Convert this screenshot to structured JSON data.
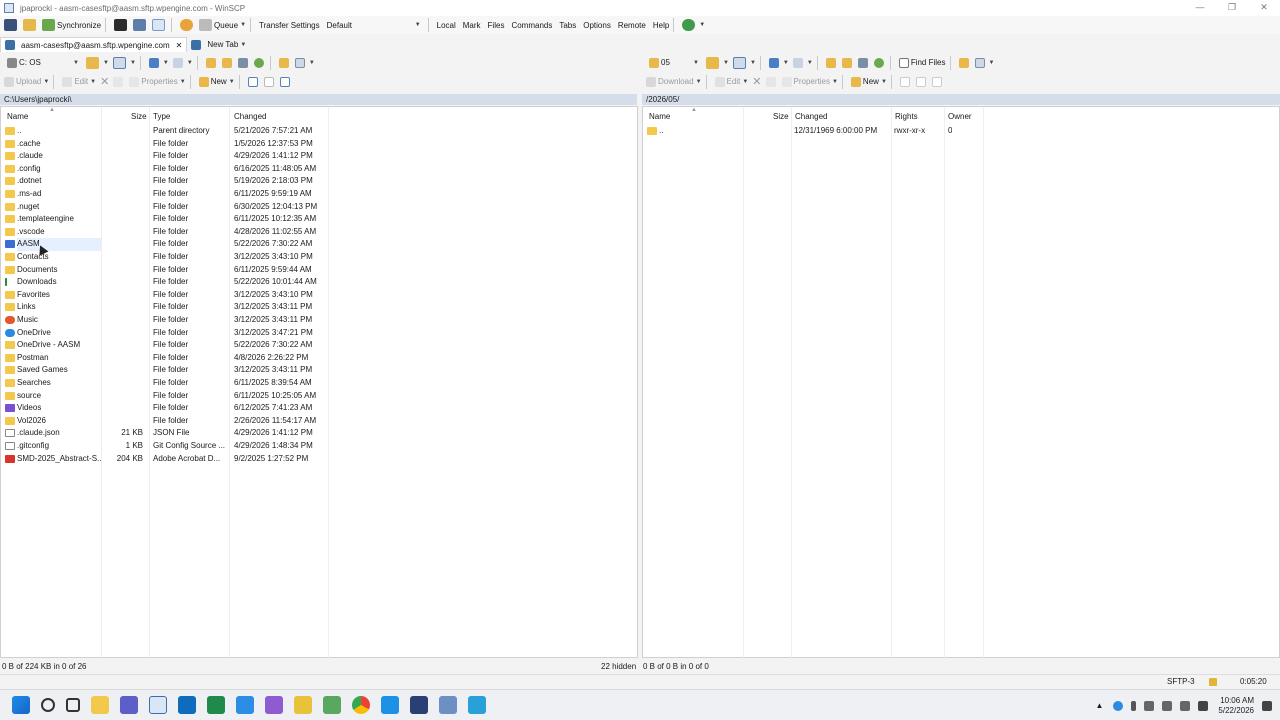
{
  "window": {
    "title": "jpaprocki - aasm-casesftp@aasm.sftp.wpengine.com - WinSCP",
    "controls": [
      "—",
      "❐",
      "✕"
    ]
  },
  "toolbar": {
    "synchronize": "Synchronize",
    "queue": "Queue",
    "transfer_settings": "Transfer Settings",
    "transfer_preset": "Default",
    "menus": [
      "Local",
      "Mark",
      "Files",
      "Commands",
      "Tabs",
      "Options",
      "Remote",
      "Help"
    ]
  },
  "tabs": {
    "session": "aasm-casesftp@aasm.sftp.wpengine.com",
    "close": "✕",
    "new_tab": "New Tab"
  },
  "left": {
    "drive": "C: OS",
    "upload": "Upload",
    "edit": "Edit",
    "properties": "Properties",
    "new": "New",
    "path": "C:\\Users\\jpaprocki\\",
    "columns": {
      "name": "Name",
      "size": "Size",
      "type": "Type",
      "changed": "Changed"
    },
    "files": [
      {
        "name": "..",
        "size": "",
        "type": "Parent directory",
        "changed": "5/21/2026 7:57:21 AM",
        "icon": "up-folder"
      },
      {
        "name": ".cache",
        "size": "",
        "type": "File folder",
        "changed": "1/5/2026 12:37:53 PM",
        "icon": "folder"
      },
      {
        "name": ".claude",
        "size": "",
        "type": "File folder",
        "changed": "4/29/2026 1:41:12 PM",
        "icon": "folder"
      },
      {
        "name": ".config",
        "size": "",
        "type": "File folder",
        "changed": "6/16/2025 11:48:05 AM",
        "icon": "folder"
      },
      {
        "name": ".dotnet",
        "size": "",
        "type": "File folder",
        "changed": "5/19/2026 2:18:03 PM",
        "icon": "folder"
      },
      {
        "name": ".ms-ad",
        "size": "",
        "type": "File folder",
        "changed": "6/11/2025 9:59:19 AM",
        "icon": "folder"
      },
      {
        "name": ".nuget",
        "size": "",
        "type": "File folder",
        "changed": "6/30/2025 12:04:13 PM",
        "icon": "folder"
      },
      {
        "name": ".templateengine",
        "size": "",
        "type": "File folder",
        "changed": "6/11/2025 10:12:35 AM",
        "icon": "folder"
      },
      {
        "name": ".vscode",
        "size": "",
        "type": "File folder",
        "changed": "4/28/2026 11:02:55 AM",
        "icon": "folder"
      },
      {
        "name": "AASM",
        "size": "",
        "type": "File folder",
        "changed": "5/22/2026 7:30:22 AM",
        "icon": "blue"
      },
      {
        "name": "Contacts",
        "size": "",
        "type": "File folder",
        "changed": "3/12/2025 3:43:10 PM",
        "icon": "folder"
      },
      {
        "name": "Documents",
        "size": "",
        "type": "File folder",
        "changed": "6/11/2025 9:59:44 AM",
        "icon": "folder"
      },
      {
        "name": "Downloads",
        "size": "",
        "type": "File folder",
        "changed": "5/22/2026 10:01:44 AM",
        "icon": "dl"
      },
      {
        "name": "Favorites",
        "size": "",
        "type": "File folder",
        "changed": "3/12/2025 3:43:10 PM",
        "icon": "folder"
      },
      {
        "name": "Links",
        "size": "",
        "type": "File folder",
        "changed": "3/12/2025 3:43:11 PM",
        "icon": "folder"
      },
      {
        "name": "Music",
        "size": "",
        "type": "File folder",
        "changed": "3/12/2025 3:43:11 PM",
        "icon": "red"
      },
      {
        "name": "OneDrive",
        "size": "",
        "type": "File folder",
        "changed": "3/12/2025 3:47:21 PM",
        "icon": "cloud"
      },
      {
        "name": "OneDrive - AASM",
        "size": "",
        "type": "File folder",
        "changed": "5/22/2026 7:30:22 AM",
        "icon": "folder"
      },
      {
        "name": "Postman",
        "size": "",
        "type": "File folder",
        "changed": "4/8/2026 2:26:22 PM",
        "icon": "folder"
      },
      {
        "name": "Saved Games",
        "size": "",
        "type": "File folder",
        "changed": "3/12/2025 3:43:11 PM",
        "icon": "folder"
      },
      {
        "name": "Searches",
        "size": "",
        "type": "File folder",
        "changed": "6/11/2025 8:39:54 AM",
        "icon": "folder"
      },
      {
        "name": "source",
        "size": "",
        "type": "File folder",
        "changed": "6/11/2025 10:25:05 AM",
        "icon": "folder"
      },
      {
        "name": "Videos",
        "size": "",
        "type": "File folder",
        "changed": "6/12/2025 7:41:23 AM",
        "icon": "purple"
      },
      {
        "name": "Vol2026",
        "size": "",
        "type": "File folder",
        "changed": "2/26/2026 11:54:17 AM",
        "icon": "folder"
      },
      {
        "name": ".claude.json",
        "size": "21 KB",
        "type": "JSON File",
        "changed": "4/29/2026 1:41:12 PM",
        "icon": "doc"
      },
      {
        "name": ".gitconfig",
        "size": "1 KB",
        "type": "Git Config Source ...",
        "changed": "4/29/2026 1:48:34 PM",
        "icon": "doc"
      },
      {
        "name": "SMD-2025_Abstract-S...",
        "size": "204 KB",
        "type": "Adobe Acrobat D...",
        "changed": "9/2/2025 1:27:52 PM",
        "icon": "pdf"
      }
    ],
    "status": "0 B of 224 KB in 0 of 26",
    "hidden": "22 hidden"
  },
  "right": {
    "folder": "05",
    "download": "Download",
    "edit": "Edit",
    "properties": "Properties",
    "new": "New",
    "find_files": "Find Files",
    "path": "/2026/05/",
    "columns": {
      "name": "Name",
      "size": "Size",
      "changed": "Changed",
      "rights": "Rights",
      "owner": "Owner"
    },
    "files": [
      {
        "name": "..",
        "size": "",
        "changed": "12/31/1969 6:00:00 PM",
        "rights": "rwxr-xr-x",
        "owner": "0"
      }
    ],
    "status": "0 B of 0 B in 0 of 0"
  },
  "statusbar": {
    "protocol": "SFTP-3",
    "elapsed": "0:05:20"
  },
  "taskbar": {
    "time": "10:06 AM",
    "date": "5/22/2026"
  }
}
